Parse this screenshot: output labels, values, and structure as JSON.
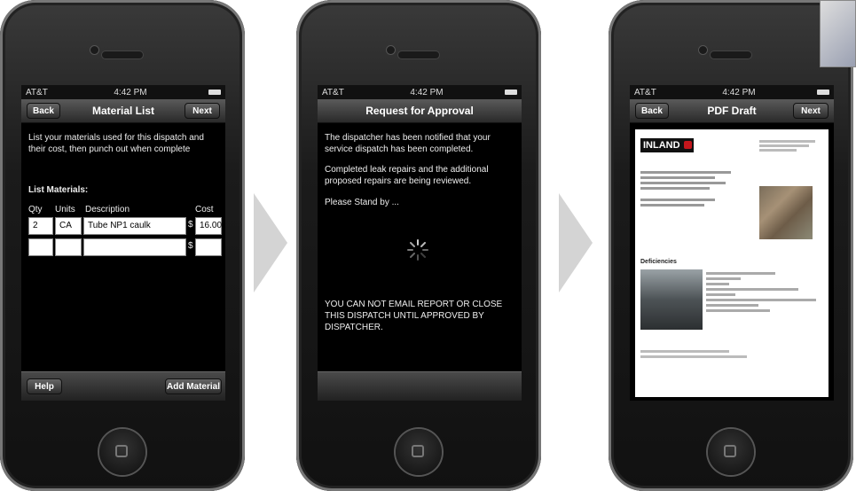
{
  "status": {
    "carrier": "AT&T",
    "time": "4:42 PM"
  },
  "screen1": {
    "back": "Back",
    "title": "Material List",
    "next": "Next",
    "intro": "List your materials used for this dispatch and their cost, then punch out when complete",
    "list_heading": "List Materials:",
    "columns": {
      "qty": "Qty",
      "units": "Units",
      "description": "Description",
      "cost": "Cost"
    },
    "row": {
      "qty": "2",
      "units": "CA",
      "description": "Tube NP1 caulk",
      "currency": "$",
      "cost": "16.00"
    },
    "currency2": "$",
    "help": "Help",
    "add_material": "Add Material"
  },
  "screen2": {
    "title": "Request for Approval",
    "p1": "The dispatcher has been notified that your service dispatch has been completed.",
    "p2": "Completed leak repairs and the additional proposed repairs are being reviewed.",
    "p3": "Please Stand by ...",
    "warning": "YOU CAN NOT EMAIL REPORT OR CLOSE THIS DISPATCH UNTIL APPROVED BY DISPATCHER."
  },
  "screen3": {
    "back": "Back",
    "title": "PDF Draft",
    "next": "Next",
    "logo": "INLAND",
    "deficiencies": "Deficiencies"
  },
  "colors": {
    "accent_red": "#c4161c"
  }
}
